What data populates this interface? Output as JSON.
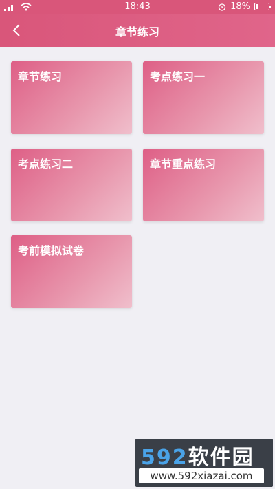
{
  "status_bar": {
    "time": "18:43",
    "battery": "18%",
    "battery_level": 0.18,
    "icons": [
      "signal-icon",
      "wifi-icon",
      "alarm-icon",
      "battery-icon"
    ]
  },
  "header": {
    "title": "章节练习",
    "back_icon": "chevron-left-icon"
  },
  "cards": [
    {
      "label": "章节练习"
    },
    {
      "label": "考点练习一"
    },
    {
      "label": "考点练习二"
    },
    {
      "label": "章节重点练习"
    },
    {
      "label": "考前模拟试卷"
    }
  ],
  "watermark": {
    "brand_number": "592",
    "brand_text": "软件园",
    "url": "www.592xiazai.com"
  },
  "colors": {
    "accent": "#d9567a",
    "background": "#f0eff4"
  }
}
